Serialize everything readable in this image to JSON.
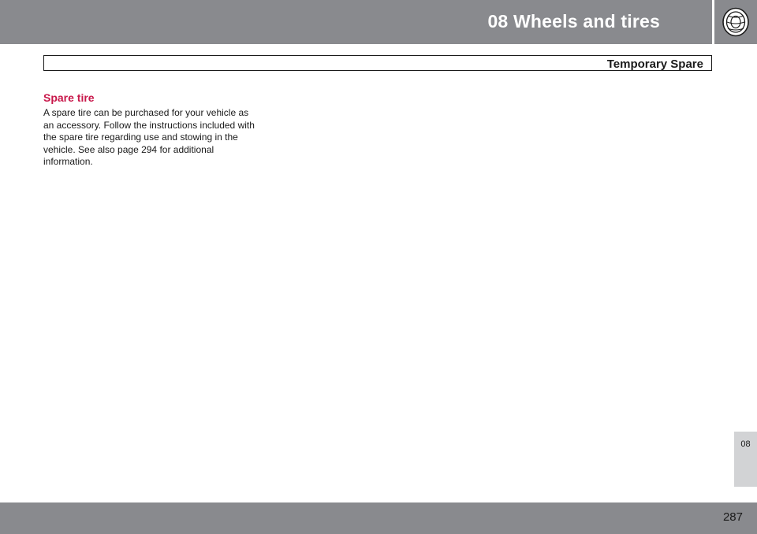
{
  "header": {
    "chapter_title": "08  Wheels and tires",
    "icon": "tire-icon"
  },
  "section": {
    "title": "Temporary Spare"
  },
  "content": {
    "heading": "Spare tire",
    "body": "A spare tire can be purchased for your vehicle as an accessory. Follow the instructions included with the spare tire regarding use and stowing in the vehicle. See also page 294 for additional information."
  },
  "side_tab": {
    "label": "08"
  },
  "footer": {
    "page_number": "287"
  },
  "colors": {
    "header_gray": "#898a8e",
    "heading_accent": "#c8174a",
    "tab_gray": "#d2d3d5"
  }
}
